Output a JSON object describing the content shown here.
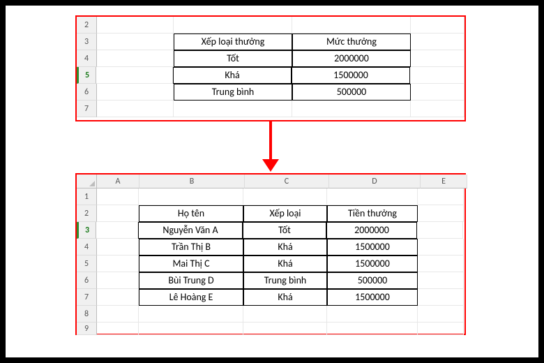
{
  "top_table": {
    "row_numbers": [
      "2",
      "3",
      "4",
      "5",
      "6",
      "7"
    ],
    "selected_row_index": 3,
    "headers": [
      "Xếp loại thưởng",
      "Mức thưởng"
    ],
    "rows": [
      [
        "Tốt",
        "2000000"
      ],
      [
        "Khá",
        "1500000"
      ],
      [
        "Trung bình",
        "500000"
      ]
    ]
  },
  "bottom_table": {
    "col_letters": [
      "A",
      "B",
      "C",
      "D",
      "E"
    ],
    "row_numbers": [
      "1",
      "2",
      "3",
      "4",
      "5",
      "6",
      "7",
      "8",
      "9"
    ],
    "selected_row_index": 2,
    "headers": [
      "Họ tên",
      "Xếp loại",
      "Tiền thưởng"
    ],
    "rows": [
      [
        "Nguyễn Văn A",
        "Tốt",
        "2000000"
      ],
      [
        "Trần Thị B",
        "Khá",
        "1500000"
      ],
      [
        "Mai Thị C",
        "Khá",
        "1500000"
      ],
      [
        "Bùi Trung D",
        "Trung bình",
        "500000"
      ],
      [
        "Lê Hoàng E",
        "Khá",
        "1500000"
      ]
    ]
  },
  "chart_data": {
    "type": "table",
    "title": "Lookup table and results",
    "lookup": {
      "columns": [
        "Xếp loại thưởng",
        "Mức thưởng"
      ],
      "rows": [
        [
          "Tốt",
          2000000
        ],
        [
          "Khá",
          1500000
        ],
        [
          "Trung bình",
          500000
        ]
      ]
    },
    "result": {
      "columns": [
        "Họ tên",
        "Xếp loại",
        "Tiền thưởng"
      ],
      "rows": [
        [
          "Nguyễn Văn A",
          "Tốt",
          2000000
        ],
        [
          "Trần Thị B",
          "Khá",
          1500000
        ],
        [
          "Mai Thị C",
          "Khá",
          1500000
        ],
        [
          "Bùi Trung D",
          "Trung bình",
          500000
        ],
        [
          "Lê Hoàng E",
          "Khá",
          1500000
        ]
      ]
    }
  }
}
